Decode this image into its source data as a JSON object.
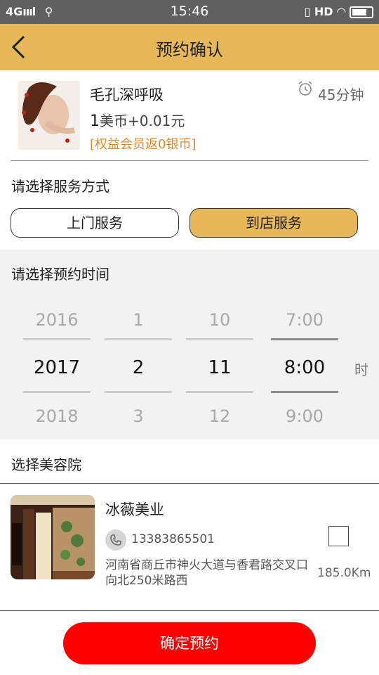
{
  "status_bar": {
    "network": "4G",
    "time": "15:46",
    "hd_label": "HD"
  },
  "header": {
    "title": "预约确认"
  },
  "product": {
    "name": "毛孔深呼吸",
    "price_main": "1",
    "price_rest": "美币+0.01元",
    "note": "[权益会员返0银币]",
    "duration": "45分钟"
  },
  "service": {
    "label": "请选择服务方式",
    "options": [
      "上门服务",
      "到店服务"
    ],
    "selected": "到店服务"
  },
  "time_picker": {
    "label": "请选择预约时间",
    "years": [
      "2016",
      "2017",
      "2018"
    ],
    "months": [
      "1",
      "2",
      "3"
    ],
    "days": [
      "10",
      "11",
      "12"
    ],
    "hours": [
      "7:00",
      "8:00",
      "9:00"
    ],
    "hour_unit": "时"
  },
  "salon_section": {
    "label": "选择美容院",
    "salon": {
      "name": "冰薇美业",
      "phone": "13383865501",
      "address": "河南省商丘市神火大道与香君路交叉口向北250米路西",
      "distance": "185.0Km"
    }
  },
  "confirm_button": {
    "label": "确定预约"
  },
  "colors": {
    "accent": "#e6b85a",
    "confirm": "#ff0000",
    "note": "#e08a2a"
  }
}
